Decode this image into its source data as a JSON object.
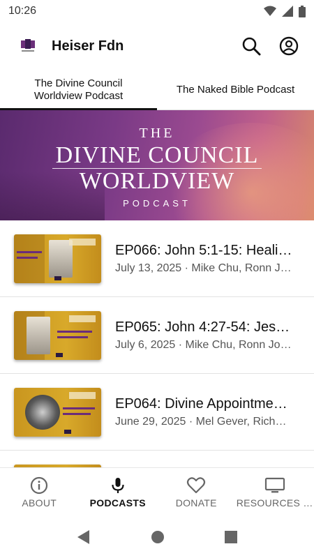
{
  "status": {
    "time": "10:26",
    "icons": [
      "wifi-icon",
      "signal-icon",
      "battery-icon"
    ]
  },
  "app_bar": {
    "title": "Heiser Fdn",
    "actions": [
      "search-icon",
      "account-icon"
    ]
  },
  "tabs": [
    {
      "label": "The Divine Council Worldview Podcast",
      "active": true
    },
    {
      "label": "The Naked Bible Podcast",
      "active": false
    }
  ],
  "banner": {
    "line_the": "THE",
    "line1": "DIVINE COUNCIL",
    "line2": "WORLDVIEW",
    "subtitle": "PODCAST"
  },
  "episodes": [
    {
      "title": "EP066: John 5:1-15: Heali…",
      "meta": "July 13, 2025 · Mike Chu, Ronn J…"
    },
    {
      "title": "EP065: John 4:27-54: Jes…",
      "meta": "July 6, 2025 · Mike Chu, Ronn Jo…"
    },
    {
      "title": "EP064: Divine Appointme…",
      "meta": "June 29, 2025 · Mel Gever, Rich…"
    }
  ],
  "bottom_nav": [
    {
      "label": "ABOUT",
      "icon": "info-icon",
      "active": false
    },
    {
      "label": "PODCASTS",
      "icon": "microphone-icon",
      "active": true
    },
    {
      "label": "DONATE",
      "icon": "heart-icon",
      "active": false
    },
    {
      "label": "RESOURCES & …",
      "icon": "tv-icon",
      "active": false
    }
  ],
  "colors": {
    "accent": "#111111",
    "thumb_gold": "#d8a92a",
    "banner_purple": "#7a3a86"
  }
}
